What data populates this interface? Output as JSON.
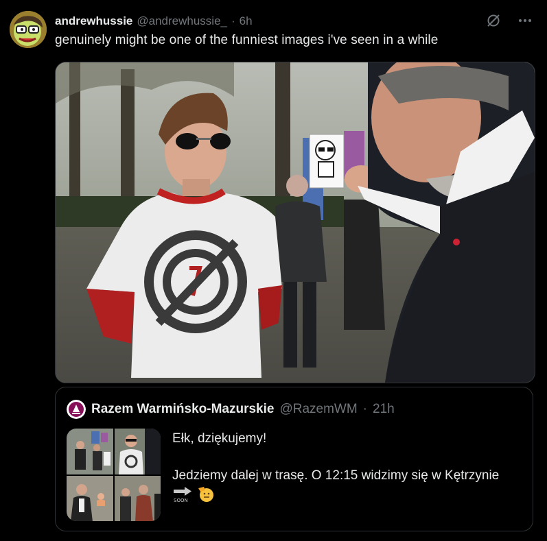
{
  "tweet": {
    "display_name": "andrewhussie",
    "handle": "@andrewhussie_",
    "separator": "·",
    "time": "6h",
    "text": "genuinely might be one of the funniest images i've seen in a while"
  },
  "top_actions": {
    "icons": [
      "grok-icon",
      "more-icon"
    ]
  },
  "quoted_tweet": {
    "display_name": "Razem Warmińsko-Mazurskie",
    "handle": "@RazemWM",
    "separator": "·",
    "time": "21h",
    "line1": "Ełk, dziękujemy!",
    "line2": "Jedziemy dalej w trasę. O 12:15 widzimy się w Kętrzynie",
    "soon_label": "SOON",
    "emoji": "saluting-face",
    "image_count": 4
  },
  "colors": {
    "background": "#000000",
    "text": "#e7e9ea",
    "muted": "#71767b",
    "border": "#2f3336",
    "razem_purple": "#870f57"
  }
}
